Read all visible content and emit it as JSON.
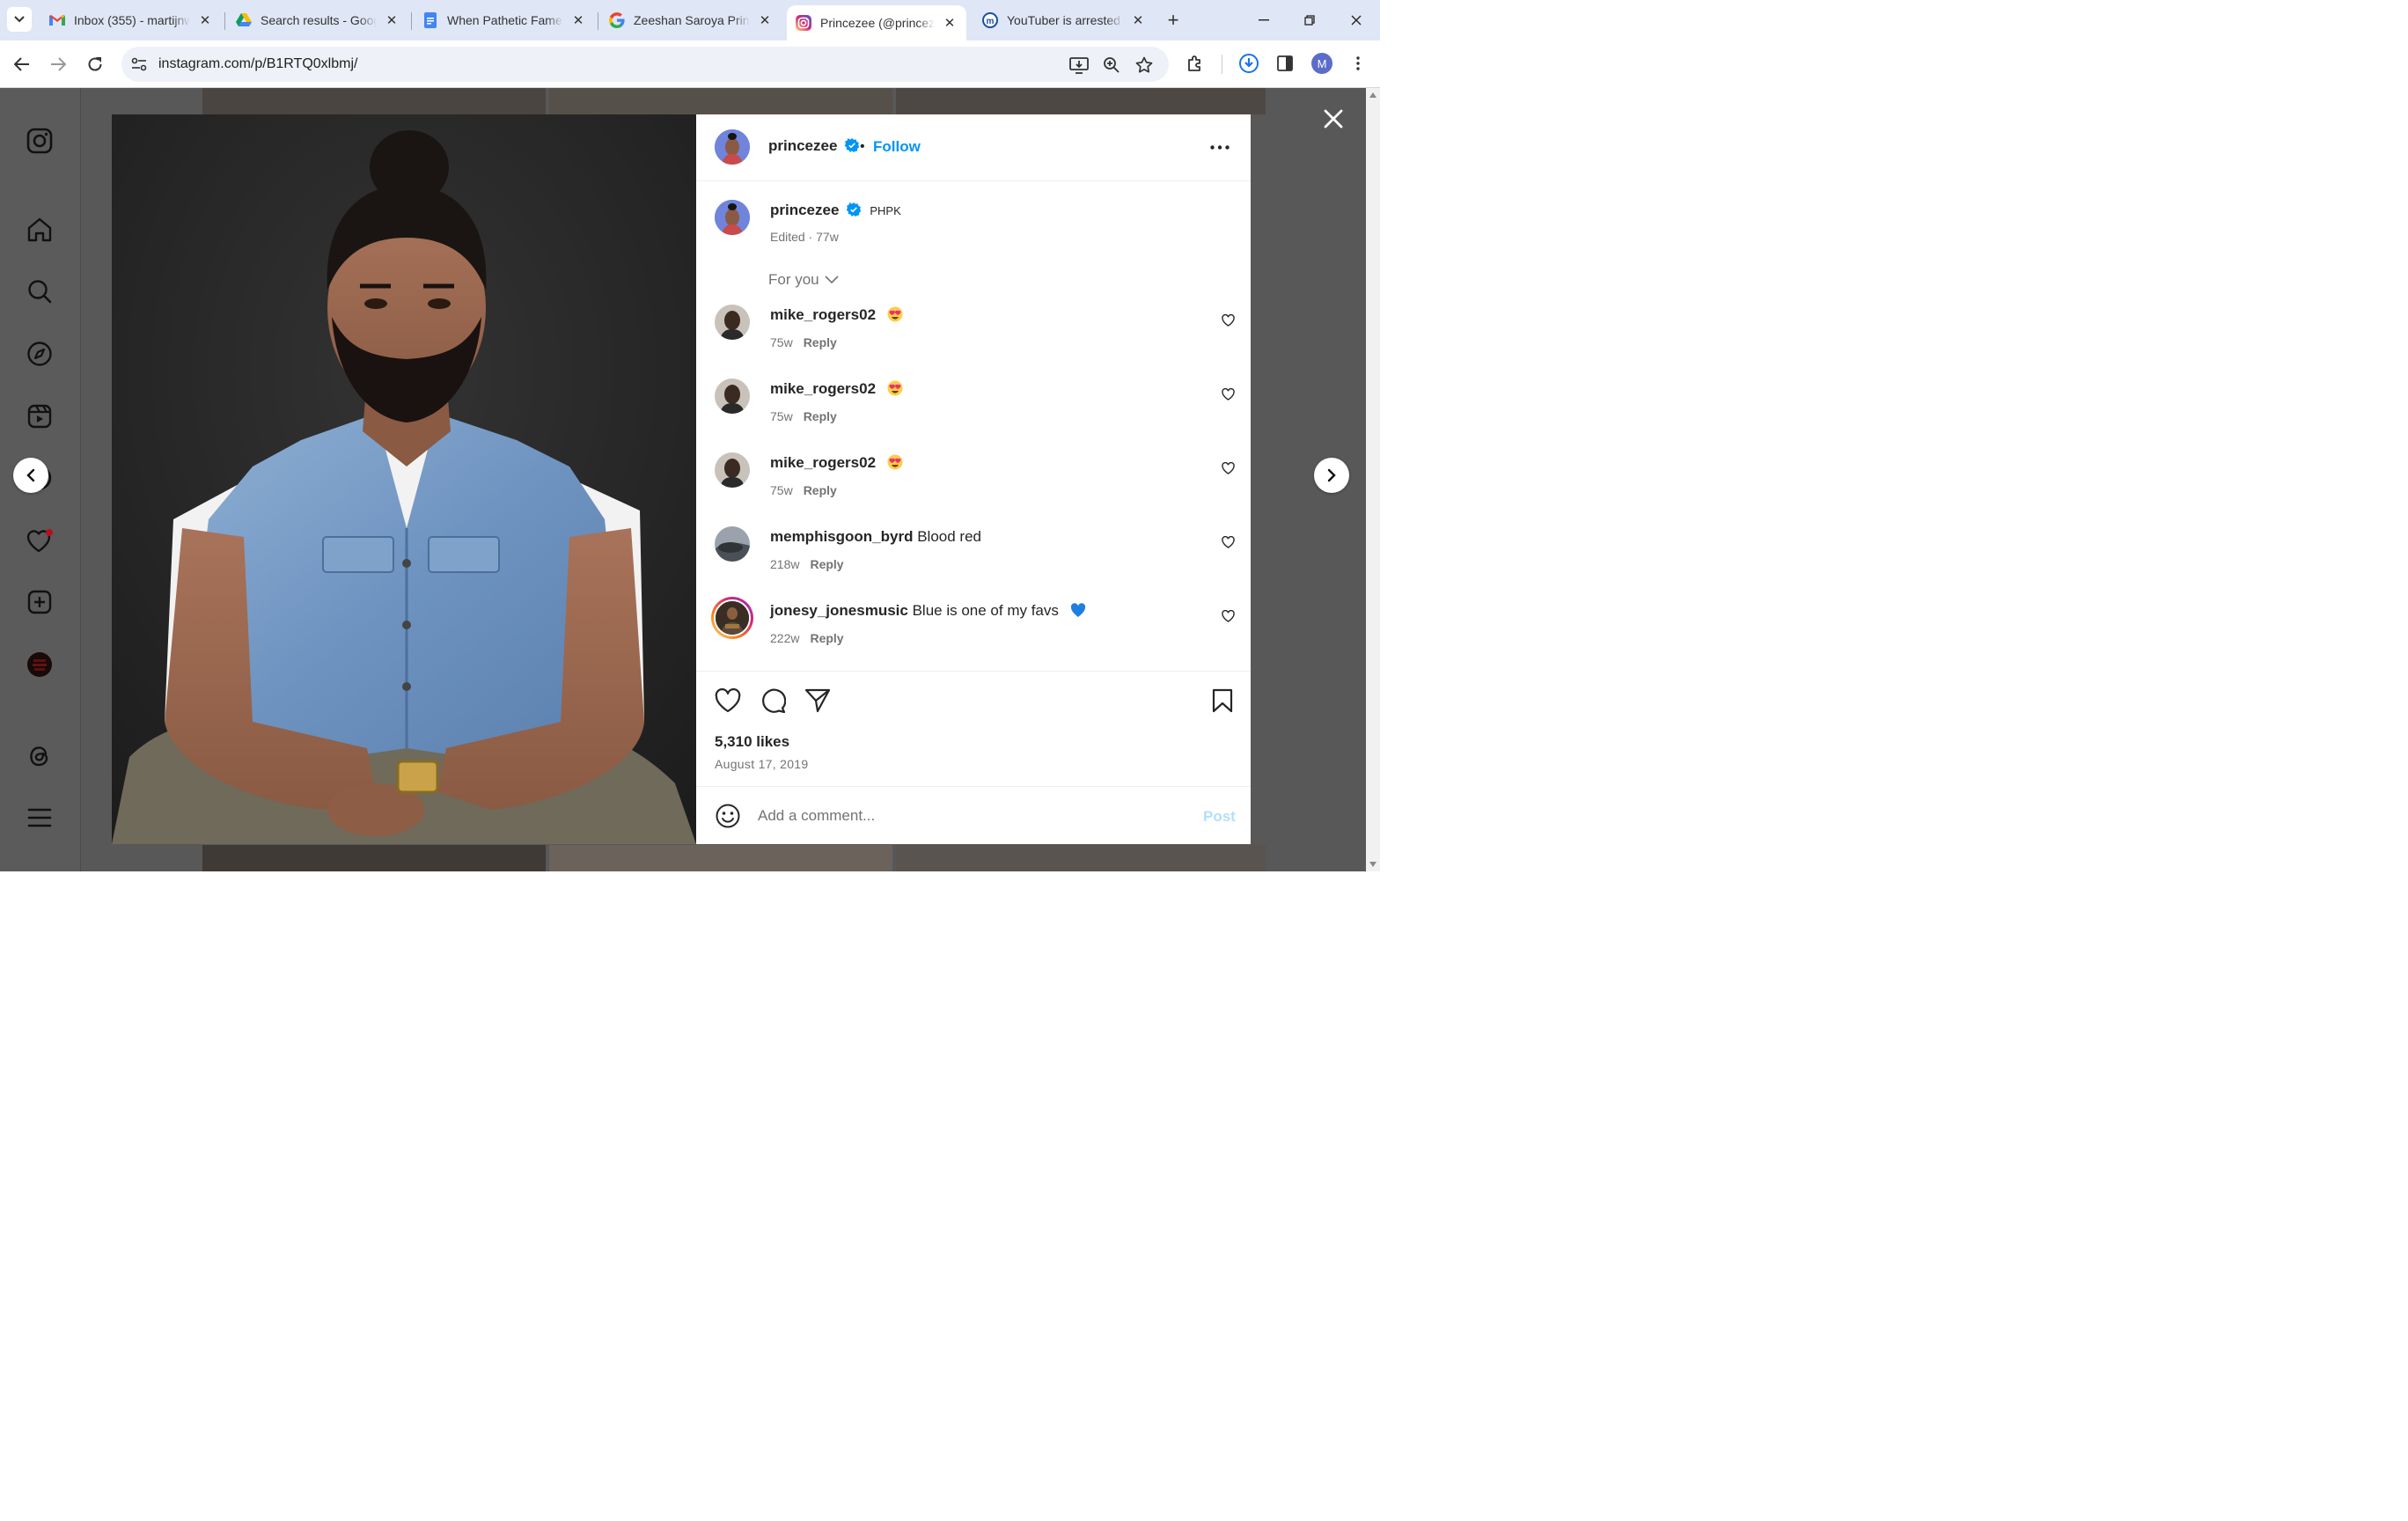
{
  "browser": {
    "tabs": [
      {
        "title": "Inbox (355) - martijnw",
        "icon": "gmail-icon"
      },
      {
        "title": "Search results - Goog",
        "icon": "google-drive-icon"
      },
      {
        "title": "When Pathetic Fame S",
        "icon": "google-docs-icon"
      },
      {
        "title": "Zeeshan Saroya Princ",
        "icon": "google-icon"
      },
      {
        "title": "Princezee (@princeze",
        "icon": "instagram-icon",
        "active": true
      },
      {
        "title": "YouTuber is arrested",
        "icon": "news-icon"
      }
    ],
    "url": "instagram.com/p/B1RTQ0xlbmj/",
    "profile_initial": "M"
  },
  "post": {
    "author": "princezee",
    "follow_label": "Follow",
    "follow_separator": "•",
    "caption": {
      "username": "princezee",
      "tag": "PHPK",
      "meta": "Edited · 77w"
    },
    "sort_label": "For you",
    "comments": [
      {
        "user": "mike_rogers02",
        "text": "",
        "emoji": "heart-eyes",
        "time": "75w",
        "reply": "Reply"
      },
      {
        "user": "mike_rogers02",
        "text": "",
        "emoji": "heart-eyes",
        "time": "75w",
        "reply": "Reply"
      },
      {
        "user": "mike_rogers02",
        "text": "",
        "emoji": "heart-eyes",
        "time": "75w",
        "reply": "Reply"
      },
      {
        "user": "memphisgoon_byrd",
        "text": "Blood red",
        "emoji": "",
        "time": "218w",
        "reply": "Reply"
      },
      {
        "user": "jonesy_jonesmusic",
        "text": "Blue is one of my favs",
        "emoji": "blue-heart",
        "time": "222w",
        "reply": "Reply"
      }
    ],
    "likes": "5,310 likes",
    "date": "August 17, 2019",
    "add_comment_placeholder": "Add a comment...",
    "post_label": "Post"
  },
  "colors": {
    "accent": "#0095f6",
    "post_disabled": "#b2dffc",
    "overlay": "#585858"
  }
}
